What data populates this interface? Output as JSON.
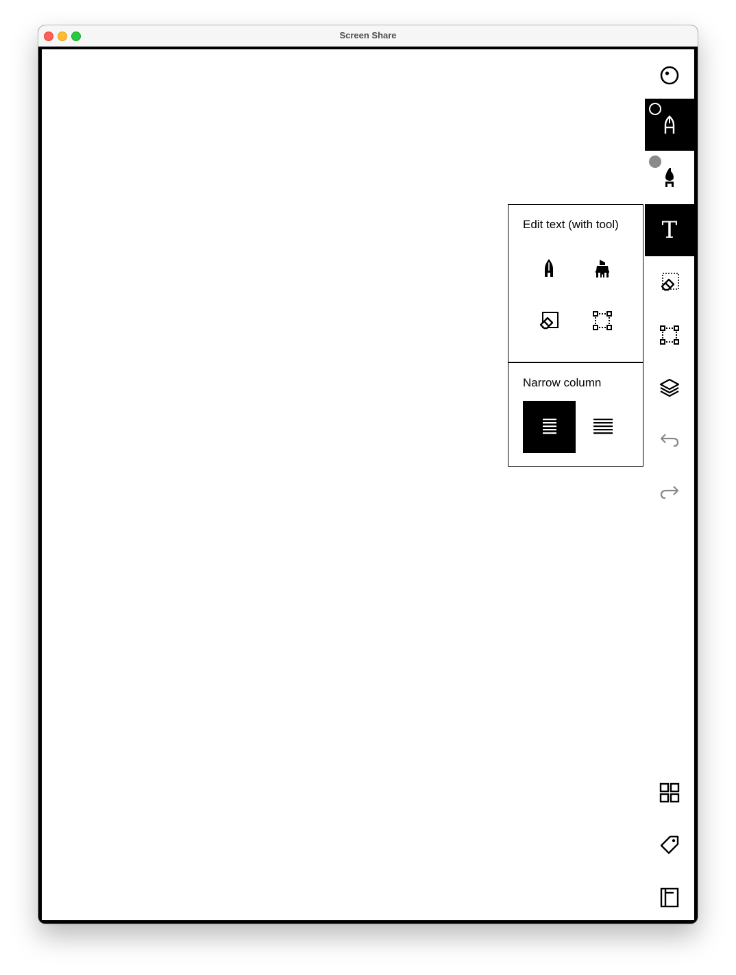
{
  "window": {
    "title": "Screen Share"
  },
  "toolbar": {
    "tools": [
      {
        "name": "focus-mode",
        "icon": "target-dot-icon",
        "active": false
      },
      {
        "name": "fineliner",
        "icon": "fineliner-pen-icon",
        "active": true,
        "badge": "ring"
      },
      {
        "name": "marker",
        "icon": "marker-pen-icon",
        "active": false,
        "badge": "filled-gray"
      },
      {
        "name": "text",
        "icon": "text-T-icon",
        "label": "T",
        "active": true
      },
      {
        "name": "eraser-selection",
        "icon": "eraser-selection-icon",
        "active": false
      },
      {
        "name": "select",
        "icon": "selection-box-icon",
        "active": false
      },
      {
        "name": "layers",
        "icon": "layers-icon",
        "active": false
      },
      {
        "name": "undo",
        "icon": "undo-arrow-icon",
        "active": false
      },
      {
        "name": "redo",
        "icon": "redo-arrow-icon",
        "active": false
      }
    ],
    "bottom": [
      {
        "name": "grid-view",
        "icon": "grid-icon"
      },
      {
        "name": "tags",
        "icon": "tag-icon"
      },
      {
        "name": "notebook",
        "icon": "notebook-icon"
      }
    ]
  },
  "text_popover": {
    "title": "Edit text (with tool)",
    "tools": [
      "fineliner-icon",
      "highlighter-icon",
      "eraser-icon",
      "selection-icon"
    ],
    "column_title": "Narrow column",
    "column_options": [
      {
        "name": "narrow",
        "icon": "narrow-column-icon",
        "selected": true
      },
      {
        "name": "wide",
        "icon": "wide-column-icon",
        "selected": false
      }
    ]
  },
  "colors": {
    "active": "#000000",
    "badge_gray": "#8a8a8a",
    "disabled_icon": "#888888"
  }
}
